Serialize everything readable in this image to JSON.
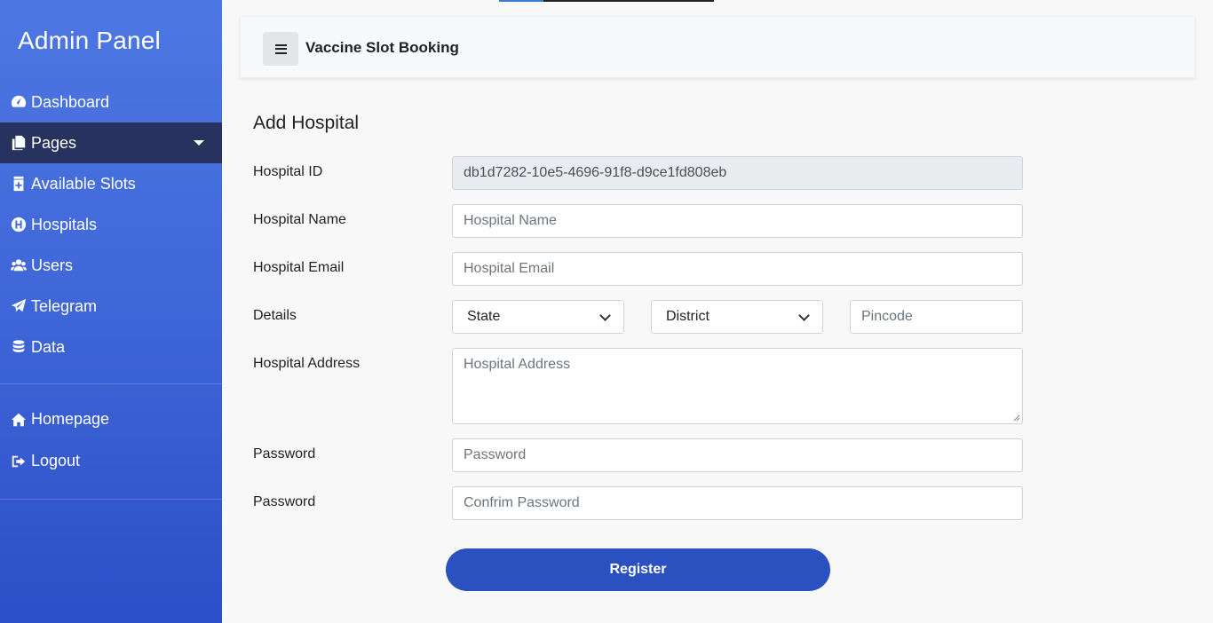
{
  "sidebar": {
    "brand": "Admin Panel",
    "items": [
      {
        "label": "Dashboard",
        "icon": "dashboard-icon"
      },
      {
        "label": "Pages",
        "icon": "pages-icon",
        "active": true
      },
      {
        "label": "Available Slots",
        "icon": "slots-icon"
      },
      {
        "label": "Hospitals",
        "icon": "hospital-icon"
      },
      {
        "label": "Users",
        "icon": "users-icon"
      },
      {
        "label": "Telegram",
        "icon": "telegram-icon"
      },
      {
        "label": "Data",
        "icon": "database-icon"
      }
    ],
    "secondary": [
      {
        "label": "Homepage",
        "icon": "home-icon"
      },
      {
        "label": "Logout",
        "icon": "logout-icon"
      }
    ]
  },
  "header": {
    "title": "Vaccine Slot Booking"
  },
  "form": {
    "title": "Add Hospital",
    "hospital_id": {
      "label": "Hospital ID",
      "value": "db1d7282-10e5-4696-91f8-d9ce1fd808eb"
    },
    "hospital_name": {
      "label": "Hospital Name",
      "placeholder": "Hospital Name"
    },
    "hospital_email": {
      "label": "Hospital Email",
      "placeholder": "Hospital Email"
    },
    "details": {
      "label": "Details",
      "state": "State",
      "district": "District",
      "pincode_placeholder": "Pincode"
    },
    "hospital_address": {
      "label": "Hospital Address",
      "placeholder": "Hospital Address"
    },
    "password": {
      "label": "Password",
      "placeholder": "Password"
    },
    "confirm_password": {
      "label": "Password",
      "placeholder": "Confrim Password"
    },
    "submit_label": "Register"
  },
  "colors": {
    "sidebar_top": "#4d77e3",
    "sidebar_bottom": "#2b4fc6",
    "active_item": "#27325e",
    "button": "#2b50c0"
  }
}
